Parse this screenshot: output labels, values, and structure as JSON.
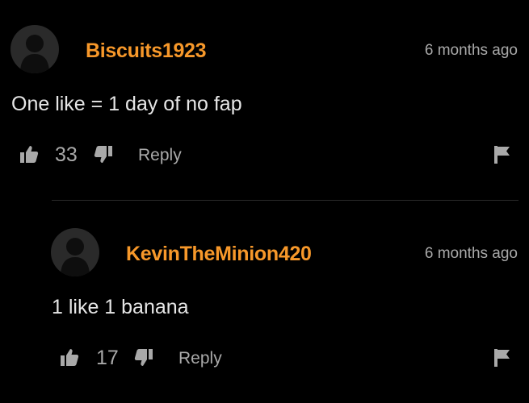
{
  "comments": [
    {
      "username": "Biscuits1923",
      "timestamp": "6 months ago",
      "text": "One like = 1 day of no fap",
      "likes": "33",
      "reply_label": "Reply"
    },
    {
      "username": "KevinTheMinion420",
      "timestamp": "6 months ago",
      "text": "1 like 1 banana",
      "likes": "17",
      "reply_label": "Reply"
    }
  ],
  "colors": {
    "background": "#000000",
    "username": "#f7982a",
    "text": "#e6e6e6",
    "muted": "#a9a9a9",
    "avatar": "#2a2a2a"
  },
  "icons": [
    "avatar-icon",
    "thumbs-up-icon",
    "thumbs-down-icon",
    "flag-icon"
  ]
}
